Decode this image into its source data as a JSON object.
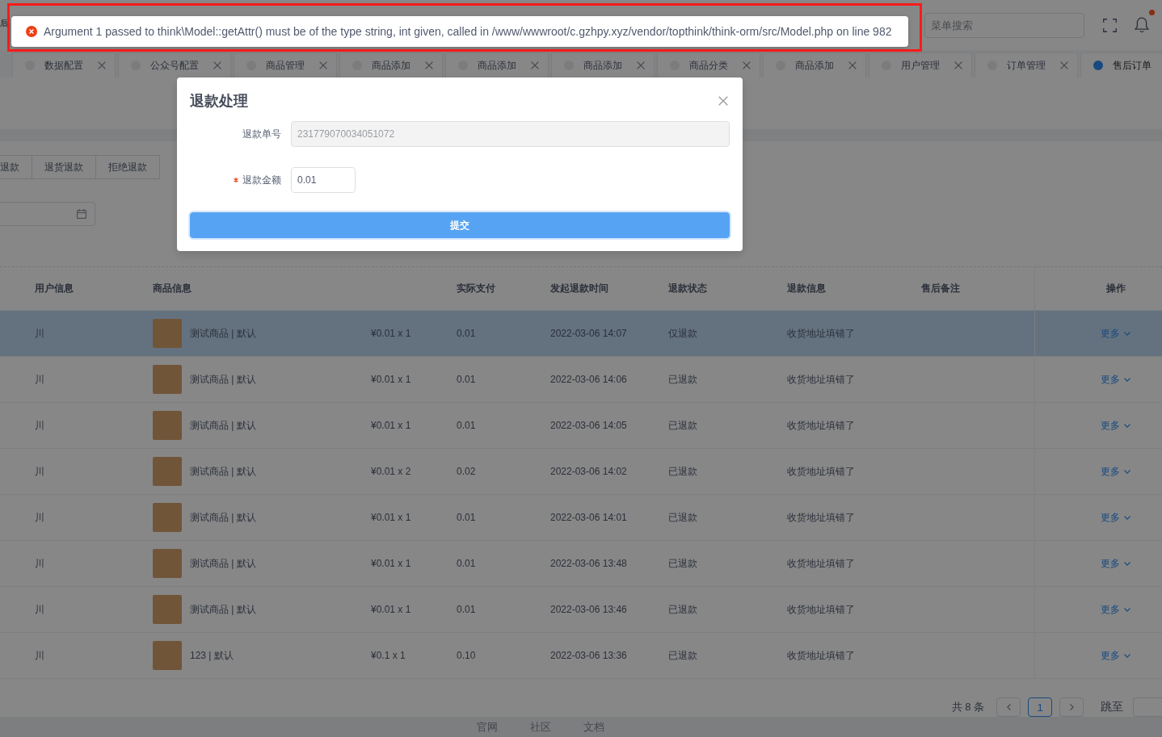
{
  "header": {
    "breadcrumb": "后",
    "search": {
      "placeholder": "菜单搜索"
    },
    "notifications": {
      "unread": true
    }
  },
  "tabs": [
    {
      "label": "数据配置",
      "selected": false
    },
    {
      "label": "公众号配置",
      "selected": false
    },
    {
      "label": "商品管理",
      "selected": false
    },
    {
      "label": "商品添加",
      "selected": false
    },
    {
      "label": "商品添加",
      "selected": false
    },
    {
      "label": "商品添加",
      "selected": false
    },
    {
      "label": "商品分类",
      "selected": false
    },
    {
      "label": "商品添加",
      "selected": false
    },
    {
      "label": "用户管理",
      "selected": false
    },
    {
      "label": "订单管理",
      "selected": false
    },
    {
      "label": "售后订单",
      "selected": true
    }
  ],
  "filter": {
    "tabs": [
      {
        "label": "退款",
        "selected": false
      },
      {
        "label": "退货退款",
        "selected": false
      },
      {
        "label": "拒绝退款",
        "selected": false
      }
    ]
  },
  "table": {
    "columns": [
      "用户信息",
      "商品信息",
      "实际支付",
      "发起退款时间",
      "退款状态",
      "退款信息",
      "售后备注",
      "操作"
    ],
    "rows": [
      {
        "highlighted": true,
        "user": "川",
        "product": "测试商品 | 默认",
        "price": "¥0.01 x 1",
        "paid": "0.01",
        "time": "2022-03-06 14:07",
        "status": "仅退款",
        "info": "收货地址填错了",
        "action": "更多"
      },
      {
        "highlighted": false,
        "user": "川",
        "product": "测试商品 | 默认",
        "price": "¥0.01 x 1",
        "paid": "0.01",
        "time": "2022-03-06 14:06",
        "status": "已退款",
        "info": "收货地址填错了",
        "action": "更多"
      },
      {
        "highlighted": false,
        "user": "川",
        "product": "测试商品 | 默认",
        "price": "¥0.01 x 1",
        "paid": "0.01",
        "time": "2022-03-06 14:05",
        "status": "已退款",
        "info": "收货地址填错了",
        "action": "更多"
      },
      {
        "highlighted": false,
        "user": "川",
        "product": "测试商品 | 默认",
        "price": "¥0.01 x 2",
        "paid": "0.02",
        "time": "2022-03-06 14:02",
        "status": "已退款",
        "info": "收货地址填错了",
        "action": "更多"
      },
      {
        "highlighted": false,
        "user": "川",
        "product": "测试商品 | 默认",
        "price": "¥0.01 x 1",
        "paid": "0.01",
        "time": "2022-03-06 14:01",
        "status": "已退款",
        "info": "收货地址填错了",
        "action": "更多"
      },
      {
        "highlighted": false,
        "user": "川",
        "product": "测试商品 | 默认",
        "price": "¥0.01 x 1",
        "paid": "0.01",
        "time": "2022-03-06 13:48",
        "status": "已退款",
        "info": "收货地址填错了",
        "action": "更多"
      },
      {
        "highlighted": false,
        "user": "川",
        "product": "测试商品 | 默认",
        "price": "¥0.01 x 1",
        "paid": "0.01",
        "time": "2022-03-06 13:46",
        "status": "已退款",
        "info": "收货地址填错了",
        "action": "更多"
      },
      {
        "highlighted": false,
        "user": "川",
        "product": "123 | 默认",
        "price": "¥0.1 x 1",
        "paid": "0.10",
        "time": "2022-03-06 13:36",
        "status": "已退款",
        "info": "收货地址填错了",
        "action": "更多"
      }
    ]
  },
  "pagination": {
    "total": "共 8 条",
    "pages": [
      {
        "label": "1",
        "selected": true
      }
    ],
    "jump_label": "跳至"
  },
  "footer": {
    "links": [
      "官网",
      "社区",
      "文档"
    ]
  },
  "modal": {
    "title": "退款处理",
    "fields": [
      {
        "kind": "text",
        "label": "退款单号",
        "value": "231779070034051072",
        "disabled": true,
        "required": false
      },
      {
        "kind": "amount",
        "label": "退款金额",
        "value": "0.01",
        "disabled": false,
        "required": true
      }
    ],
    "submit": "提交"
  },
  "message": {
    "kind": "error",
    "text": "Argument 1 passed to think\\Model::getAttr() must be of the type string, int given, called in /www/wwwroot/c.gzhpy.xyz/vendor/topthink/think-orm/src/Model.php on line 982",
    "highlighted": true
  }
}
